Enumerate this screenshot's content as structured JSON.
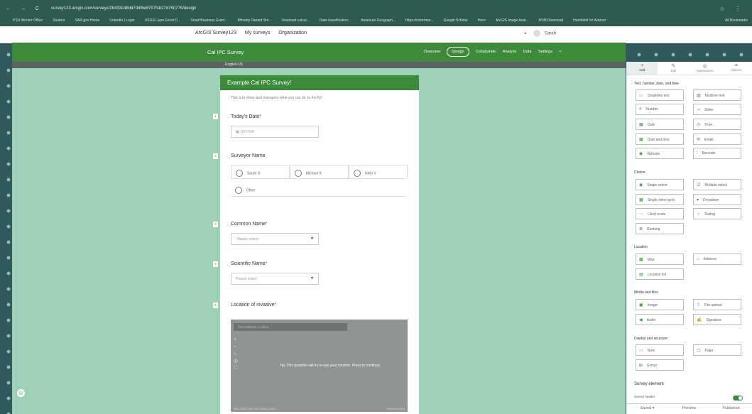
{
  "browser": {
    "url": "survey123.arcgis.com/surveys/2b433c48dd7d4f6e9757fcb27d750776/design",
    "bookmarks": [
      "PSU Worker Office",
      "Student",
      "SAM.gov Home",
      "LinkedIn | Login",
      "USGS Layer Excel D...",
      "Small Business Grant...",
      "Minority Owned Sm...",
      "Unsolved calcul...",
      "Data classification...",
      "American Geograph...",
      "https://colormes...",
      "Google Scholar",
      "Hero",
      "ArcGIS Image Anal...",
      "RVM Download",
      "Humboldt Iot Advisor"
    ],
    "all_bookmarks": "All Bookmarks"
  },
  "app": {
    "title": "ArcGIS Survey123",
    "menu": [
      "My surveys",
      "Organization"
    ],
    "user": "Sarah"
  },
  "survey": {
    "name": "Cal IPC Survey",
    "tabs": [
      "Overview",
      "Design",
      "Collaborate",
      "Analyze",
      "Data",
      "Settings"
    ],
    "active_tab": "Design",
    "language": "English-US"
  },
  "form": {
    "header": "Example Cal IPC Survey!",
    "description": "This is to show land managers what you can do on the fly!",
    "q1": {
      "num": "1",
      "title": "Today's Date",
      "value": "10/17/24"
    },
    "q2": {
      "num": "2",
      "title": "Surveyor Name",
      "options": [
        "Sarah G",
        "Michael K",
        "Nikki V",
        "Other"
      ]
    },
    "q3": {
      "num": "3",
      "title": "Common Name",
      "placeholder": "-Please select-"
    },
    "q4": {
      "num": "4",
      "title": "Scientific Name",
      "placeholder": "Please select"
    },
    "q5": {
      "num": "5",
      "title": "Location of invasive",
      "search_placeholder": "Find address or place",
      "tip": "Tip: This question will try to use your location. Press to continue.",
      "attribution": "Esri, USGS | Esri, FAO, NOAA, USGS",
      "powered": "Powered by Esri"
    }
  },
  "panel": {
    "tabs": [
      "Add",
      "Edit",
      "Appearance",
      "Options"
    ],
    "sections": {
      "text": "Text, number, date, and time",
      "choice": "Choice",
      "location": "Location",
      "media": "Media and files",
      "display": "Display and structure",
      "element": "Survey element"
    },
    "items": {
      "single_line": "Singleline text",
      "multi_line": "Multiline text",
      "number": "Number",
      "slider": "Slider",
      "date": "Date",
      "time": "Time",
      "date_time": "Date and time",
      "email": "Email",
      "website": "Website",
      "barcode": "Barcode",
      "single_select": "Single select",
      "multiple_select": "Multiple select",
      "single_select_grid": "Single select grid",
      "dropdown": "Dropdown",
      "likert": "Likert scale",
      "rating": "Rating",
      "ranking": "Ranking",
      "map": "Map",
      "address": "Address",
      "location_list": "Location list",
      "image": "Image",
      "file_upload": "File upload",
      "audio": "Audio",
      "signature": "Signature",
      "note": "Note",
      "page": "Page",
      "group": "Group"
    },
    "survey_header": "Survey header",
    "footer": [
      "Saved",
      "Preview",
      "Published"
    ]
  }
}
